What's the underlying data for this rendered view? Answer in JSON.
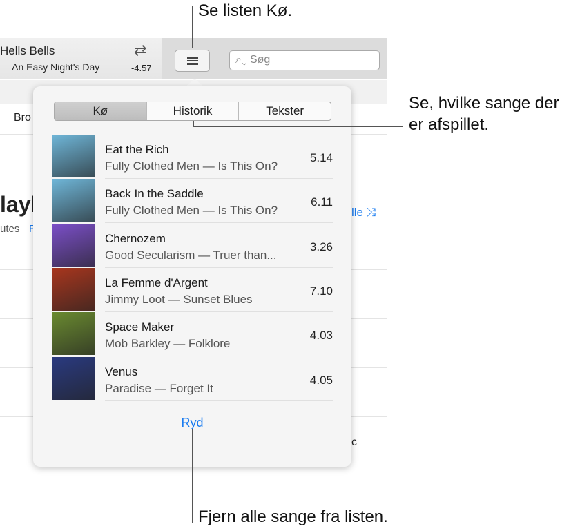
{
  "now_playing": {
    "title": "Hells Bells",
    "subtitle": "— An Easy Night's Day",
    "time": "-4.57"
  },
  "toolbar": {
    "repeat_icon": "repeat-icon",
    "queue_icon": "list-icon",
    "search_placeholder": "Søg"
  },
  "background": {
    "nav": "Bro",
    "heading": "layl",
    "meta": "utes",
    "edit": "R",
    "shuffle": "lle",
    "cell": "c"
  },
  "popover": {
    "tabs": [
      {
        "label": "Kø",
        "selected": true
      },
      {
        "label": "Historik",
        "selected": false
      },
      {
        "label": "Tekster",
        "selected": false
      }
    ],
    "songs": [
      {
        "title": "Eat the Rich",
        "subtitle": "Fully Clothed Men — Is This On?",
        "duration": "5.14",
        "art": "#6fb6d8"
      },
      {
        "title": "Back In the Saddle",
        "subtitle": "Fully Clothed Men — Is This On?",
        "duration": "6.11",
        "art": "#6fb6d8"
      },
      {
        "title": "Chernozem",
        "subtitle": "Good Secularism — Truer than...",
        "duration": "3.26",
        "art": "#7b4fc8"
      },
      {
        "title": "La Femme d'Argent",
        "subtitle": "Jimmy Loot — Sunset Blues",
        "duration": "7.10",
        "art": "#a8361e"
      },
      {
        "title": "Space Maker",
        "subtitle": "Mob Barkley — Folklore",
        "duration": "4.03",
        "art": "#6a8a30"
      },
      {
        "title": "Venus",
        "subtitle": "Paradise — Forget It",
        "duration": "4.05",
        "art": "#2a3a80"
      }
    ],
    "clear_label": "Ryd"
  },
  "callouts": {
    "queue": "Se listen Kø.",
    "history": "Se, hvilke sange der er afspillet.",
    "clear": "Fjern alle sange fra listen."
  },
  "colors": {
    "accent": "#1a7cf0"
  }
}
